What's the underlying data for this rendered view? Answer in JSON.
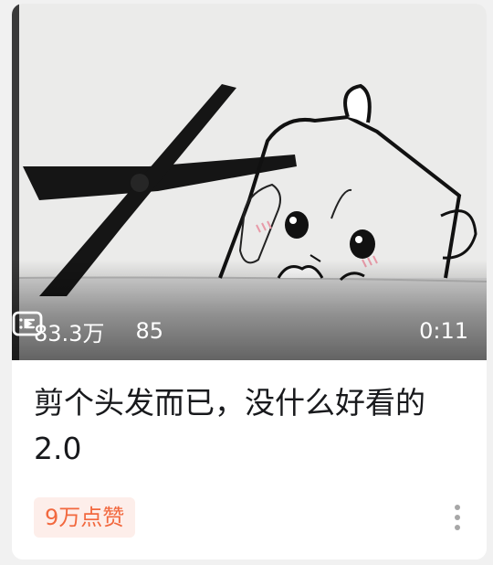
{
  "video": {
    "views": "83.3万",
    "danmaku": "85",
    "duration": "0:11"
  },
  "title": "剪个头发而已，没什么好看的2.0",
  "likes_badge": "9万点赞",
  "icons": {
    "views": "play-count-icon",
    "danmaku": "danmaku-icon",
    "more": "more-vertical-icon"
  },
  "colors": {
    "badge_text": "#f2683e",
    "badge_bg": "#fdeeea",
    "title": "#18191c"
  }
}
